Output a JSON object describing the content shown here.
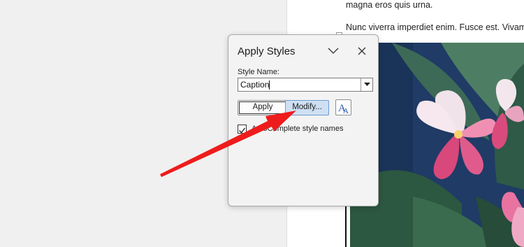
{
  "document": {
    "line1": "magna eros quis urna.",
    "line2": "Nunc viverra imperdiet enim. Fusce est. Vivamus"
  },
  "dialog": {
    "title": "Apply Styles",
    "style_name_label": "Style Name:",
    "style_name_value": "Caption",
    "apply_label": "Apply",
    "modify_label": "Modify...",
    "autocomplete_label": "AutoComplete style names",
    "autocomplete_checked": true
  },
  "icons": {
    "collapse": "chevron-down-icon",
    "close": "close-icon",
    "dropdown": "dropdown-arrow-icon",
    "styles_pane": "styles-pane-icon",
    "checkbox": "checkmark-icon"
  },
  "colors": {
    "annotation_arrow": "#ee1c1c",
    "modify_button_bg": "#cfe0f3",
    "photo_background": "#1e3a64"
  }
}
